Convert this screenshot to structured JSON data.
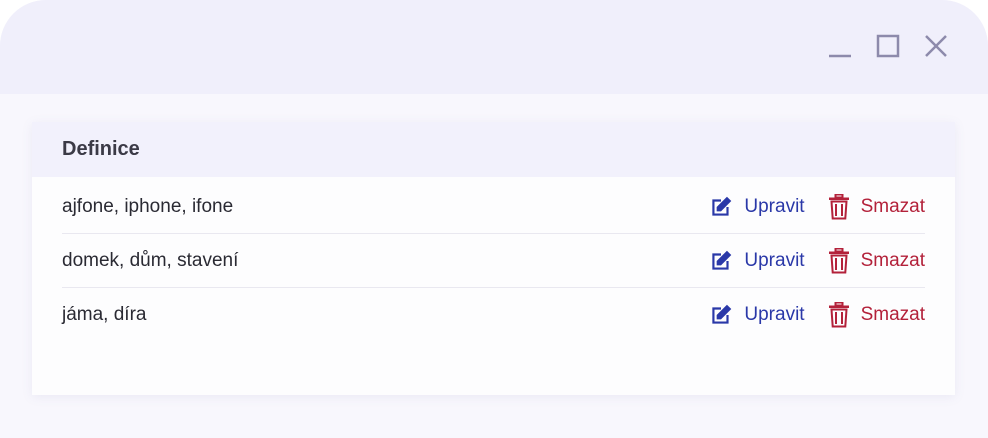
{
  "window": {
    "controls": {
      "minimize_icon": "minimize-icon",
      "maximize_icon": "maximize-icon",
      "close_icon": "close-icon"
    }
  },
  "card": {
    "title": "Definice",
    "rows": [
      {
        "text": "ajfone, iphone, ifone",
        "edit_label": "Upravit",
        "delete_label": "Smazat"
      },
      {
        "text": "domek, dům, stavení",
        "edit_label": "Upravit",
        "delete_label": "Smazat"
      },
      {
        "text": "jáma, díra",
        "edit_label": "Upravit",
        "delete_label": "Smazat"
      }
    ]
  },
  "colors": {
    "edit": "#2a38a8",
    "delete": "#b3213a",
    "titlebar": "#f0effb",
    "window_controls": "#8d8aab"
  }
}
